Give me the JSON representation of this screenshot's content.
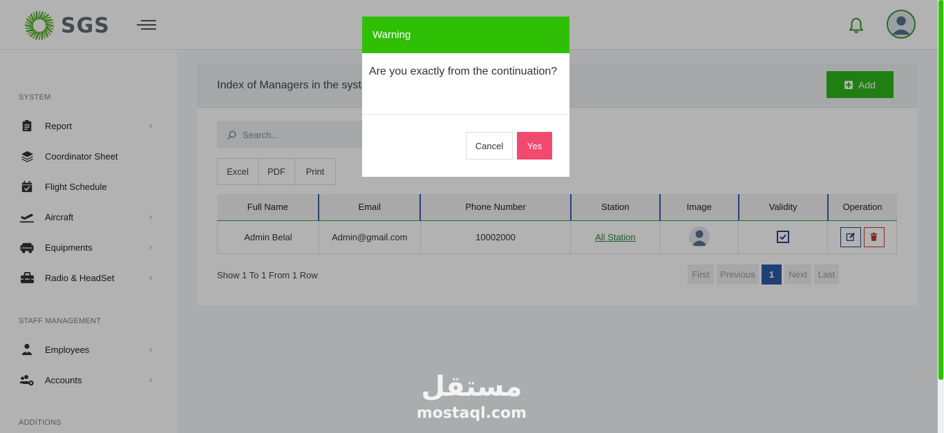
{
  "header": {
    "brand": "SGS",
    "logo_icon": "sgs-logo-icon",
    "menu_icon": "hamburger-icon",
    "notification_icon": "bell-icon",
    "avatar_icon": "user-avatar-icon"
  },
  "sidebar": {
    "sections": [
      {
        "title": "SYSTEM",
        "items": [
          {
            "label": "Report",
            "icon": "clipboard-icon",
            "has_chevron": true
          },
          {
            "label": "Coordinator Sheet",
            "icon": "layers-icon",
            "has_chevron": false
          },
          {
            "label": "Flight Schedule",
            "icon": "calendar-check-icon",
            "has_chevron": false
          },
          {
            "label": "Aircraft",
            "icon": "plane-departure-icon",
            "has_chevron": true
          },
          {
            "label": "Equipments",
            "icon": "truck-icon",
            "has_chevron": true
          },
          {
            "label": "Radio & HeadSet",
            "icon": "toolbox-icon",
            "has_chevron": true
          }
        ]
      },
      {
        "title": "STAFF MANAGEMENT",
        "items": [
          {
            "label": "Employees",
            "icon": "user-tie-icon",
            "has_chevron": true
          },
          {
            "label": "Accounts",
            "icon": "users-cog-icon",
            "has_chevron": true
          }
        ]
      },
      {
        "title": "ADDITIONS",
        "items": []
      }
    ],
    "chevron": "›"
  },
  "main": {
    "title": "Index of Managers in the system",
    "add_label": "Add",
    "search_placeholder": "Search...",
    "export_buttons": [
      "Excel",
      "PDF",
      "Print"
    ],
    "table": {
      "columns": [
        "Full Name",
        "Email",
        "Phone Number",
        "Station",
        "Image",
        "Validity",
        "Operation"
      ],
      "rows": [
        {
          "full_name": "Admin Belal",
          "email": "Admin@gmail.com",
          "phone": "10002000",
          "station": "All Station",
          "validity": true
        }
      ]
    },
    "rows_info": "Show 1 To 1 From 1 Row",
    "pagination": [
      "First",
      "Previous",
      "1",
      "Next",
      "Last"
    ],
    "current_page": "1"
  },
  "modal": {
    "title": "Warning",
    "message": "Are you exactly from the continuation?",
    "cancel_label": "Cancel",
    "confirm_label": "Yes"
  },
  "colors": {
    "brand_green": "#2fc006",
    "confirm_pink": "#f2496f",
    "table_header_divider": "#3a5ba8",
    "pagination_active": "#2e5ba8"
  },
  "watermark": {
    "arabic": "مستقل",
    "latin": "mostaql.com"
  }
}
